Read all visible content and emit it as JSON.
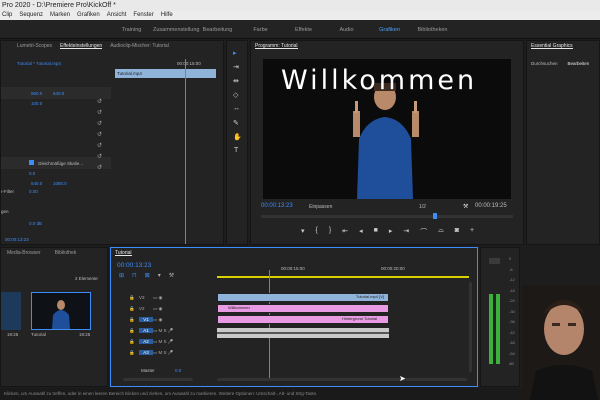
{
  "window": {
    "title": "Pro 2020 - D:\\Premiere Pro\\KickOff *"
  },
  "menu": [
    "Clip",
    "Sequenz",
    "Marken",
    "Grafiken",
    "Ansicht",
    "Fenster",
    "Hilfe"
  ],
  "workspaces": {
    "tabs": [
      "Training",
      "Zusammenstellung",
      "Bearbeitung",
      "Farbe",
      "Effekte",
      "Audio",
      "Grafiken",
      "Bibliotheken"
    ],
    "active": "Grafiken"
  },
  "effects_panel": {
    "tabs": [
      "Lumetri-Scopes",
      "Effekteinstellungen",
      "Audioclip-Mischer: Tutorial"
    ],
    "breadcrumb": "Tutorial * Tutorial.mp4",
    "timecode": "00:00:15:00",
    "clip_label": "Tutorial.mp4",
    "values": [
      "960.0",
      "540.0",
      "100.0",
      "540.0",
      "1080.0",
      "Gleichmäßige Skalie...",
      "0.0",
      "0.00"
    ],
    "truncated_labels": [
      "r-Filter",
      "gen",
      "e-Kanal"
    ],
    "bottom_value": "0.0 dB",
    "bottom_timecode": "00:00:13:23"
  },
  "program": {
    "tab": "Programm: Tutorial",
    "overlay_text": "Willkommen",
    "timecode": "00:00:13:23",
    "fit": "Einpassen",
    "resolution": "1/2",
    "duration": "00:00:19:25"
  },
  "essential_graphics": {
    "title": "Essential Graphics",
    "tabs": [
      "Durchsuchen",
      "Bearbeiten"
    ]
  },
  "project": {
    "tabs": [
      "Media-Browser",
      "Bibliothek"
    ],
    "count": "2 Elemente",
    "items": [
      {
        "name": "",
        "duration": "19:25"
      },
      {
        "name": "Tutorial",
        "duration": "19:25"
      }
    ]
  },
  "timeline": {
    "tab": "Tutorial",
    "timecode": "00:00:13:23",
    "ruler": [
      "00:00:15:00",
      "00:00:20:00"
    ],
    "tracks": [
      "V3",
      "V2",
      "V1",
      "A1",
      "A2",
      "A3"
    ],
    "clips": {
      "v3": "Tutorial.mp4 [V]",
      "v2": "Willkommen",
      "v1": "Hintergrund Tutorial"
    },
    "master_label": "Master",
    "master_value": "0.0"
  },
  "meter_scale": [
    "0",
    "-6",
    "-12",
    "-18",
    "-24",
    "-30",
    "-36",
    "-42",
    "-48",
    "-54",
    "dB"
  ],
  "status": "Klicken, um Auswahl zu treffen, oder in einen leeren Bereich klicken und ziehen, um Auswahl zu markieren. Weitere Optionen: Umschalt-, Alt- und Strg-Taste.",
  "colors": {
    "accent": "#3c8dfa",
    "clip_blue": "#8fb3d9",
    "clip_pink": "#e89be2",
    "meter": "#3db03d"
  }
}
